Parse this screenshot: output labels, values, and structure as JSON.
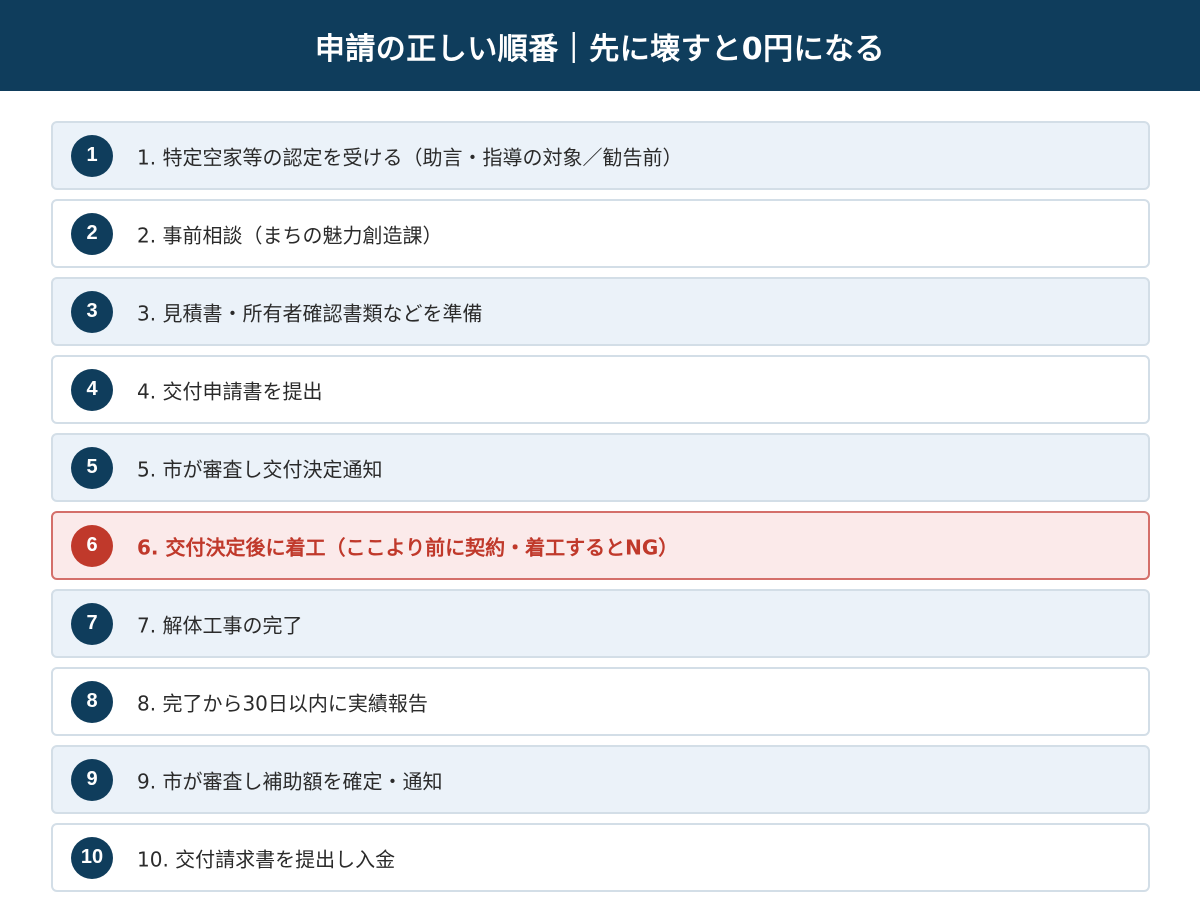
{
  "header": {
    "title": "申請の正しい順番｜先に壊すと0円になる"
  },
  "colors": {
    "header_bg": "#0f3d5c",
    "badge_bg": "#0f3d5c",
    "alert": "#c0392b",
    "alert_bg": "#fbeaea",
    "row_shade": "#ebf2f9"
  },
  "steps": [
    {
      "number": "1",
      "label": "1. 特定空家等の認定を受ける（助言・指導の対象／勧告前）"
    },
    {
      "number": "2",
      "label": "2. 事前相談（まちの魅力創造課）"
    },
    {
      "number": "3",
      "label": "3. 見積書・所有者確認書類などを準備"
    },
    {
      "number": "4",
      "label": "4. 交付申請書を提出"
    },
    {
      "number": "5",
      "label": "5. 市が審査し交付決定通知"
    },
    {
      "number": "6",
      "label": "6. 交付決定後に着工（ここより前に契約・着工するとNG）"
    },
    {
      "number": "7",
      "label": "7. 解体工事の完了"
    },
    {
      "number": "8",
      "label": "8. 完了から30日以内に実績報告"
    },
    {
      "number": "9",
      "label": "9. 市が審査し補助額を確定・通知"
    },
    {
      "number": "10",
      "label": "10. 交付請求書を提出し入金"
    }
  ]
}
